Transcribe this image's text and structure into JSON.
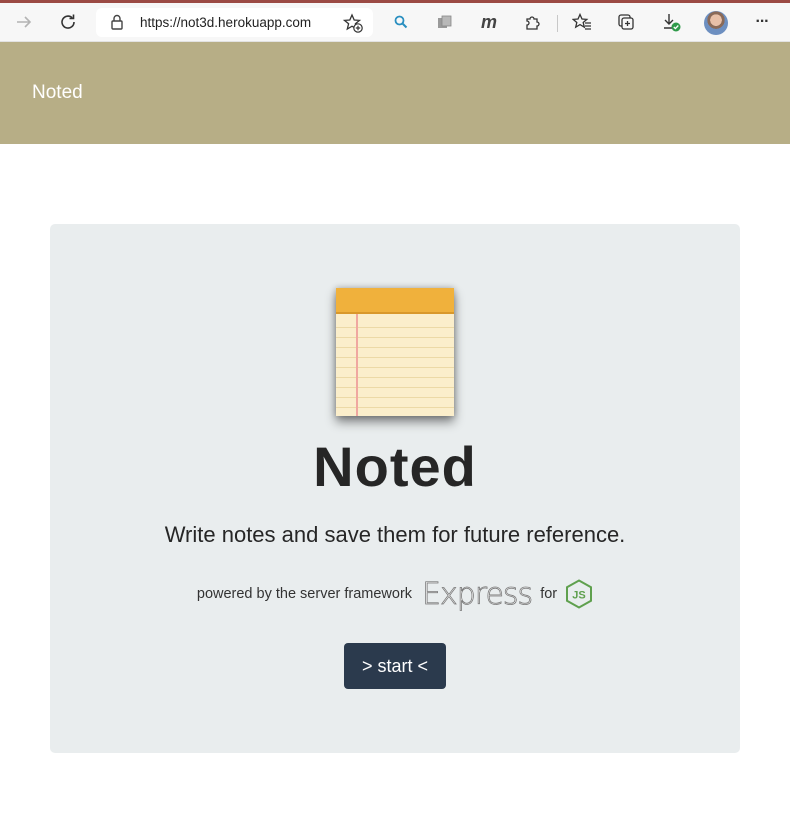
{
  "browser": {
    "url": "https://not3d.herokuapp.com",
    "icons": [
      "forward-icon",
      "refresh-icon",
      "lock-icon",
      "add-favorite-icon",
      "search-extension-icon",
      "collections-extension-icon",
      "m-extension-icon",
      "extensions-icon",
      "favorites-icon",
      "collections-icon",
      "downloads-icon",
      "avatar",
      "more-icon"
    ],
    "m_label": "m",
    "more_label": "···"
  },
  "header": {
    "brand": "Noted"
  },
  "jumbotron": {
    "title": "Noted",
    "lead": "Write notes and save them for future reference.",
    "powered_text": "powered by the server framework",
    "express_logo": "Express",
    "for_text": "for",
    "node_logo_text": "JS",
    "start_button": "> start <"
  },
  "colors": {
    "header_bg": "#b7ae86",
    "jumbotron_bg": "#e9edee",
    "button_bg": "#2b3a4d",
    "notepad_top": "#f0b13c",
    "node_green": "#5fa04e"
  }
}
